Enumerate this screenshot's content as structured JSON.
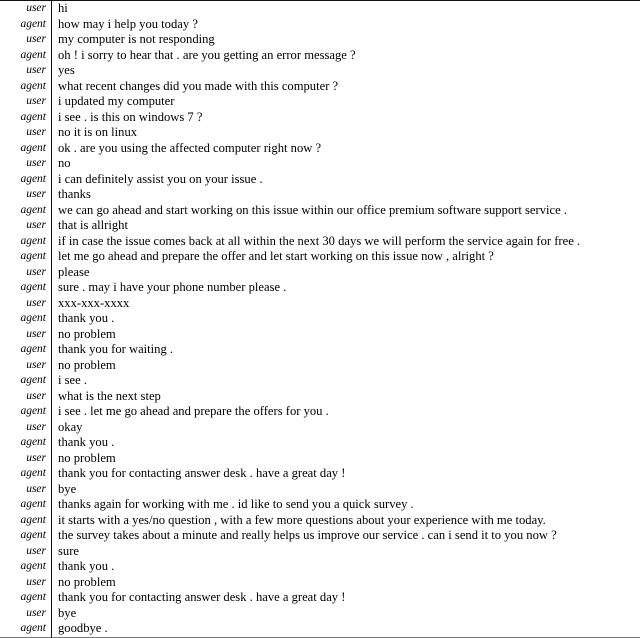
{
  "document": {
    "type": "dialogue-transcript",
    "speaker_column_header": "",
    "utterance_column_header": "",
    "speakers": [
      "user",
      "agent"
    ],
    "turn_count": 40
  },
  "turns": [
    {
      "speaker": "user",
      "text": "hi"
    },
    {
      "speaker": "agent",
      "text": "how may i help you today ?"
    },
    {
      "speaker": "user",
      "text": "my computer is not responding"
    },
    {
      "speaker": "agent",
      "text": "oh ! i sorry to hear that . are you getting an error message ?"
    },
    {
      "speaker": "user",
      "text": "yes"
    },
    {
      "speaker": "agent",
      "text": "what recent changes did you made with this computer ?"
    },
    {
      "speaker": "user",
      "text": "i updated my computer"
    },
    {
      "speaker": "agent",
      "text": "i see . is this on windows 7 ?"
    },
    {
      "speaker": "user",
      "text": "no it is on linux"
    },
    {
      "speaker": "agent",
      "text": "ok . are you using the affected computer right now ?"
    },
    {
      "speaker": "user",
      "text": "no"
    },
    {
      "speaker": "agent",
      "text": "i can definitely assist you on your issue ."
    },
    {
      "speaker": "user",
      "text": "thanks"
    },
    {
      "speaker": "agent",
      "text": "we can go ahead and start working on this issue within our office premium software support service ."
    },
    {
      "speaker": "user",
      "text": "that is allright"
    },
    {
      "speaker": "agent",
      "text": "if in case the issue comes back at all within the next 30 days we will perform the service again for free ."
    },
    {
      "speaker": "agent",
      "text": "let me go ahead and prepare the offer and let start working on this issue now , alright ?"
    },
    {
      "speaker": "user",
      "text": "please"
    },
    {
      "speaker": "agent",
      "text": "sure . may i have your phone number please ."
    },
    {
      "speaker": "user",
      "text": "xxx-xxx-xxxx"
    },
    {
      "speaker": "agent",
      "text": "thank you ."
    },
    {
      "speaker": "user",
      "text": "no problem"
    },
    {
      "speaker": "agent",
      "text": "thank you for waiting ."
    },
    {
      "speaker": "user",
      "text": "no problem"
    },
    {
      "speaker": "agent",
      "text": "i see ."
    },
    {
      "speaker": "user",
      "text": "what is the next step"
    },
    {
      "speaker": "agent",
      "text": "i see . let me go ahead and prepare the offers for you ."
    },
    {
      "speaker": "user",
      "text": "okay"
    },
    {
      "speaker": "agent",
      "text": "thank you ."
    },
    {
      "speaker": "user",
      "text": "no problem"
    },
    {
      "speaker": "agent",
      "text": "thank you for contacting answer desk . have a great day !"
    },
    {
      "speaker": "user",
      "text": "bye"
    },
    {
      "speaker": "agent",
      "text": "thanks again for working with me . id like to send you a quick survey ."
    },
    {
      "speaker": "agent",
      "text": "it starts with a yes/no question , with a few more questions about your experience with me today."
    },
    {
      "speaker": "agent",
      "text": "the survey takes about a minute and really helps us improve our service . can i send it to you now ?"
    },
    {
      "speaker": "user",
      "text": "sure"
    },
    {
      "speaker": "agent",
      "text": "thank you ."
    },
    {
      "speaker": "user",
      "text": "no problem"
    },
    {
      "speaker": "agent",
      "text": "thank you for contacting answer desk . have a great day !"
    },
    {
      "speaker": "user",
      "text": "bye"
    },
    {
      "speaker": "agent",
      "text": "goodbye ."
    }
  ],
  "style": {
    "text_color": "#000000",
    "background_color": "#ffffff",
    "rule_color": "#111111",
    "bottom_rule_color": "#7a7a7a"
  }
}
